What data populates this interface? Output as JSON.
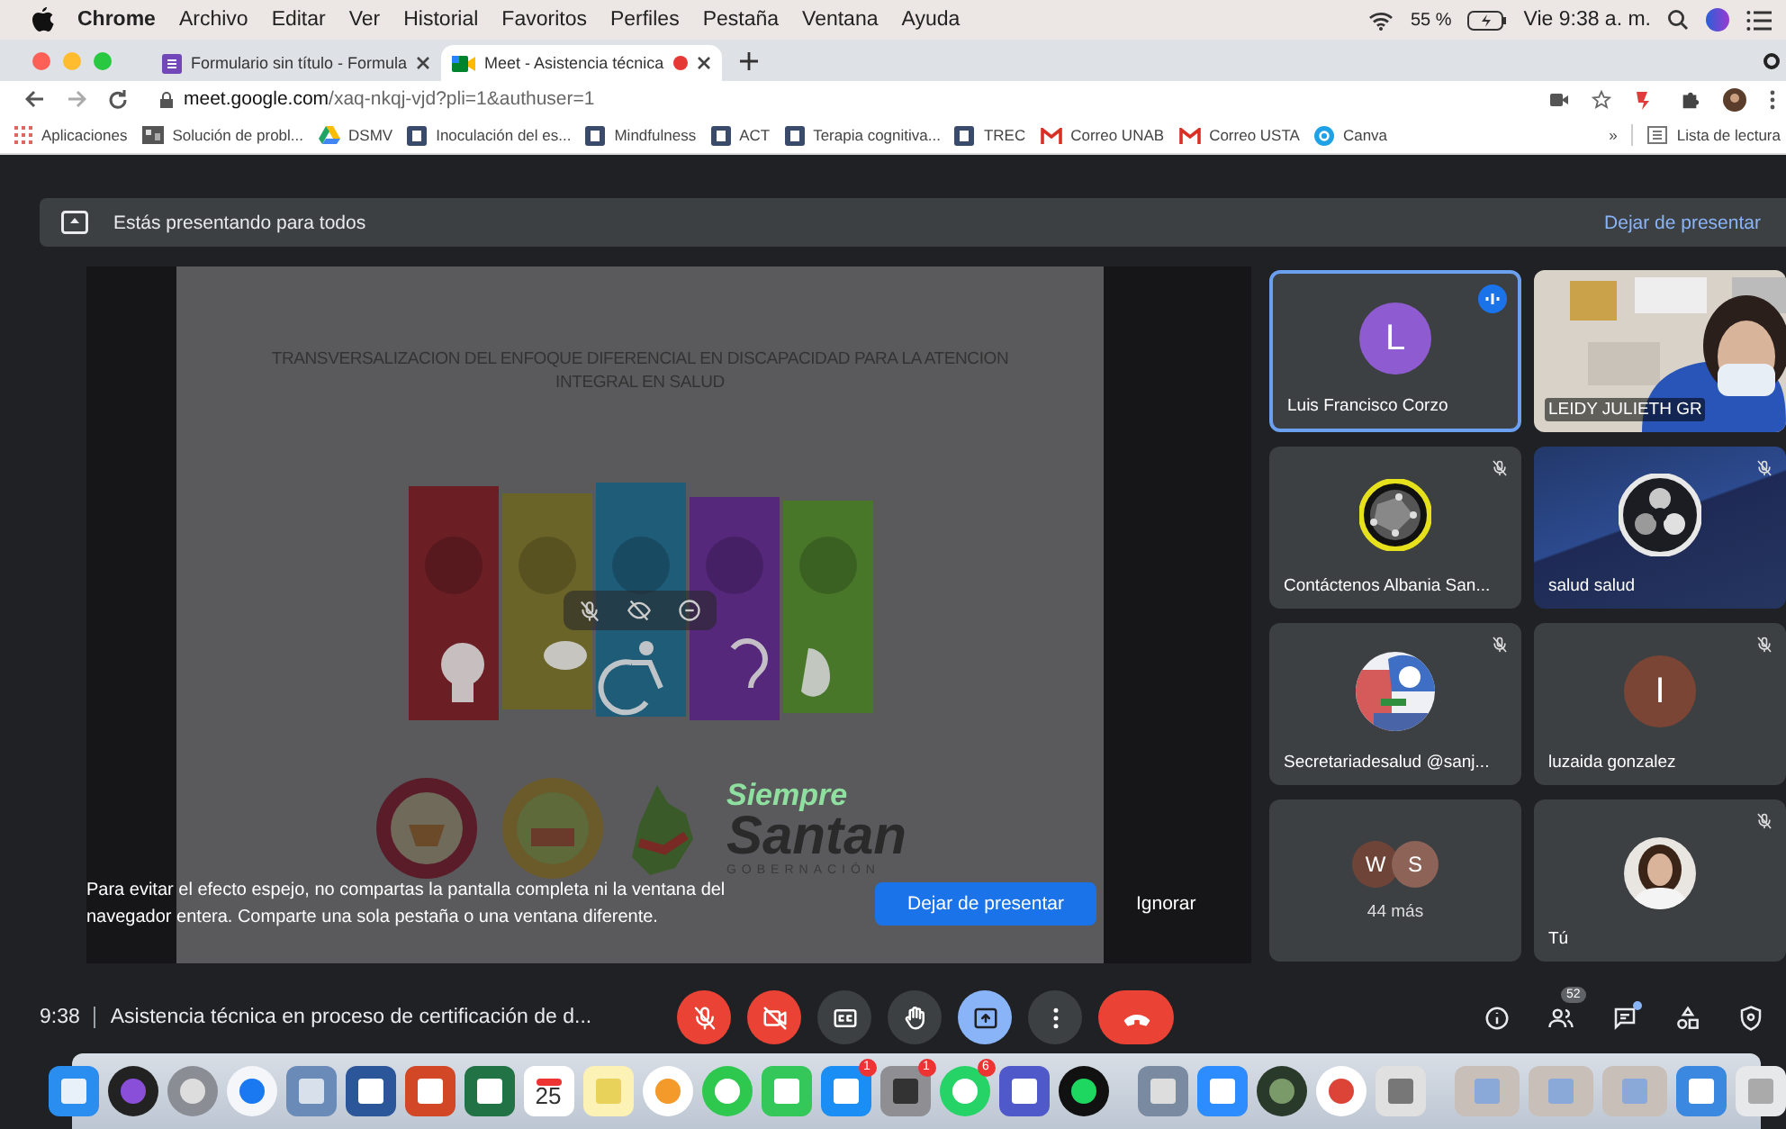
{
  "menubar": {
    "app": "Chrome",
    "menus": [
      "Archivo",
      "Editar",
      "Ver",
      "Historial",
      "Favoritos",
      "Perfiles",
      "Pestaña",
      "Ventana",
      "Ayuda"
    ],
    "battery": "55 %",
    "clock": "Vie 9:38 a. m."
  },
  "browser": {
    "tabs": [
      {
        "title": "Formulario sin título - Formula",
        "kind": "forms",
        "selected": false,
        "recording": false
      },
      {
        "title": "Meet - Asistencia técnica",
        "kind": "meet",
        "selected": true,
        "recording": true
      }
    ],
    "url_host": "meet.google.com",
    "url_path": "/xaq-nkqj-vjd?pli=1&authuser=1",
    "bookmarks": [
      {
        "label": "Aplicaciones",
        "kind": "apps"
      },
      {
        "label": "Solución de probl..."
      },
      {
        "label": "DSMV",
        "kind": "drive"
      },
      {
        "label": "Inoculación del es...",
        "kind": "doc"
      },
      {
        "label": "Mindfulness",
        "kind": "doc"
      },
      {
        "label": "ACT",
        "kind": "doc"
      },
      {
        "label": "Terapia cognitiva...",
        "kind": "doc"
      },
      {
        "label": "TREC",
        "kind": "doc"
      },
      {
        "label": "Correo UNAB",
        "kind": "gmail"
      },
      {
        "label": "Correo USTA",
        "kind": "gmail"
      },
      {
        "label": "Canva",
        "kind": "canva"
      }
    ],
    "more": "»",
    "reading_list": "Lista de lectura"
  },
  "meet": {
    "presenting_banner": "Estás presentando para todos",
    "stop_presenting_link": "Dejar de presentar",
    "slide": {
      "title": "TRANSVERSALIZACION DEL ENFOQUE DIFERENCIAL EN DISCAPACIDAD PARA LA ATENCION INTEGRAL EN SALUD",
      "brand_top": "Siempre",
      "brand_main": "Santan",
      "brand_sub": "GOBERNACIÓN"
    },
    "notice": {
      "text": "Para evitar el efecto espejo, no compartas la pantalla completa ni la ventana del navegador entera. Comparte una sola pestaña o una ventana diferente.",
      "button": "Dejar de presentar",
      "dismiss": "Ignorar"
    },
    "participants": [
      {
        "name": "Luis Francisco Corzo",
        "kind": "letter",
        "initial": "L",
        "color": "#8e5bd0",
        "speaking": true,
        "muted": false
      },
      {
        "name": "LEIDY JULIETH GR",
        "kind": "video",
        "speaking": false,
        "muted": false
      },
      {
        "name": "Contáctenos Albania San...",
        "speaking": false,
        "muted": true
      },
      {
        "name": "salud salud",
        "kind": "logo",
        "speaking": false,
        "muted": true
      },
      {
        "name": "Secretariadesalud @sanj...",
        "speaking": false,
        "muted": true
      },
      {
        "name": "luzaida gonzalez",
        "kind": "letter",
        "initial": "I",
        "color": "#7b4536",
        "speaking": false,
        "muted": true
      },
      {
        "name": "44 más",
        "kind": "more",
        "avatars": [
          {
            "initial": "W",
            "color": "#6d4437"
          },
          {
            "initial": "S",
            "color": "#8d6358"
          }
        ],
        "speaking": false,
        "muted": false
      },
      {
        "name": "Tú",
        "kind": "self",
        "speaking": false,
        "muted": true
      }
    ],
    "meeting": {
      "time": "9:38",
      "title": "Asistencia técnica en proceso de certificación de d..."
    },
    "controls": [
      {
        "kind": "mic",
        "on": false
      },
      {
        "kind": "camera",
        "on": false
      },
      {
        "kind": "captions",
        "on": false
      },
      {
        "kind": "hand",
        "on": false
      },
      {
        "kind": "present",
        "on": true
      },
      {
        "kind": "more"
      },
      {
        "kind": "leave"
      }
    ],
    "people_count": "52"
  },
  "dock": [
    {
      "kind": "finder"
    },
    {
      "kind": "siri"
    },
    {
      "kind": "launchpad"
    },
    {
      "kind": "safari"
    },
    {
      "kind": "preview"
    },
    {
      "kind": "word"
    },
    {
      "kind": "powerpoint"
    },
    {
      "kind": "excel"
    },
    {
      "kind": "calendar",
      "label": "25"
    },
    {
      "kind": "notes"
    },
    {
      "kind": "photos"
    },
    {
      "kind": "messages"
    },
    {
      "kind": "facetime"
    },
    {
      "kind": "appstore",
      "badge": "1"
    },
    {
      "kind": "settings",
      "badge": "1"
    },
    {
      "kind": "whatsapp",
      "badge": "6"
    },
    {
      "kind": "teams"
    },
    {
      "kind": "spotify"
    },
    {
      "kind": "separator"
    },
    {
      "kind": "imagecapture"
    },
    {
      "kind": "zoom"
    },
    {
      "kind": "camino"
    },
    {
      "kind": "chrome"
    },
    {
      "kind": "keychain"
    },
    {
      "kind": "separator"
    },
    {
      "kind": "thumb"
    },
    {
      "kind": "thumb"
    },
    {
      "kind": "thumb"
    },
    {
      "kind": "downloads"
    },
    {
      "kind": "trash"
    }
  ]
}
